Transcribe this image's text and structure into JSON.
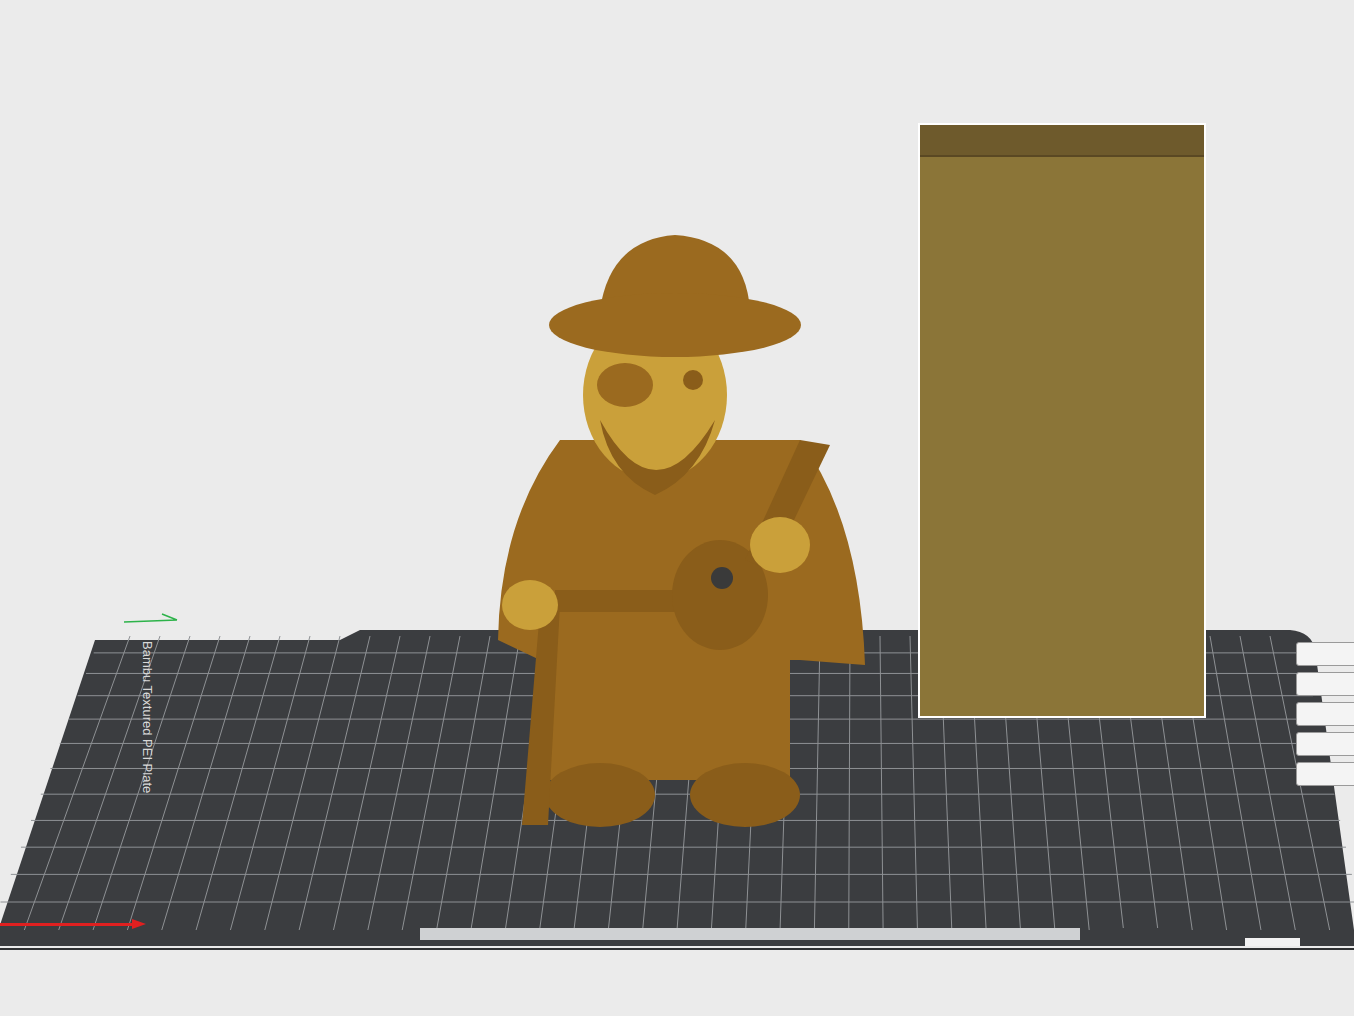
{
  "plate": {
    "label": "Bambu Textured PEI Plate"
  },
  "objects": [
    {
      "kind": "model",
      "selected": false,
      "color": "#9b6a1f"
    },
    {
      "kind": "prime-tower",
      "selected": true,
      "color": "#8b7538"
    }
  ],
  "toolbar": [
    {
      "selected": false
    },
    {
      "selected": false
    },
    {
      "selected": false
    },
    {
      "selected": false
    },
    {
      "selected": false
    }
  ]
}
